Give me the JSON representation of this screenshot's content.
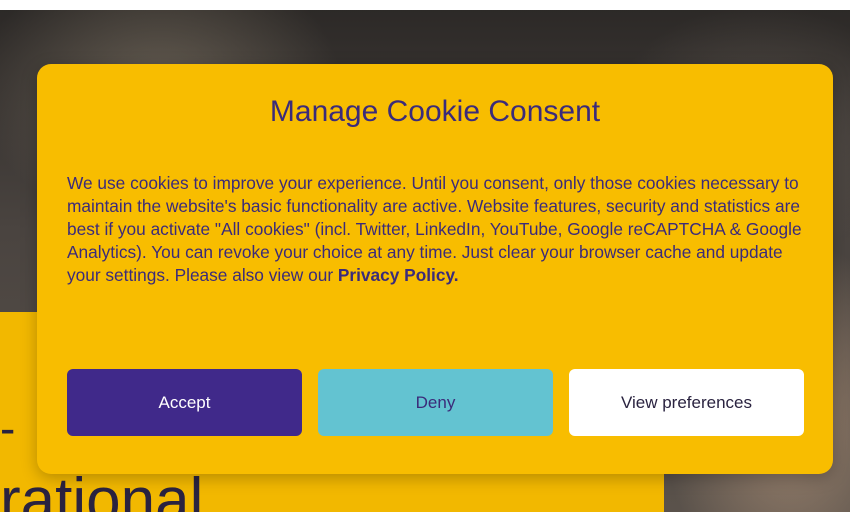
{
  "background": {
    "dash": "-",
    "heading_fragment": "rational"
  },
  "modal": {
    "title": "Manage Cookie Consent",
    "body_text": "We use cookies to improve your experience. Until you consent, only those cookies necessary to maintain the website's basic functionality are active. Website features, security and statistics are best if you activate \"All cookies\" (incl. Twitter, LinkedIn, YouTube, Google reCAPTCHA & Google Analytics). You can revoke your choice at any time. Just clear your browser cache and update your settings. Please also view our ",
    "privacy_link": "Privacy Policy.",
    "buttons": {
      "accept": "Accept",
      "deny": "Deny",
      "view_preferences": "View preferences"
    }
  },
  "colors": {
    "modal_background": "#f8bd00",
    "text_primary": "#3b2b7a",
    "accept_button": "#40298a",
    "deny_button": "#63c3d1",
    "preferences_button": "#ffffff"
  }
}
